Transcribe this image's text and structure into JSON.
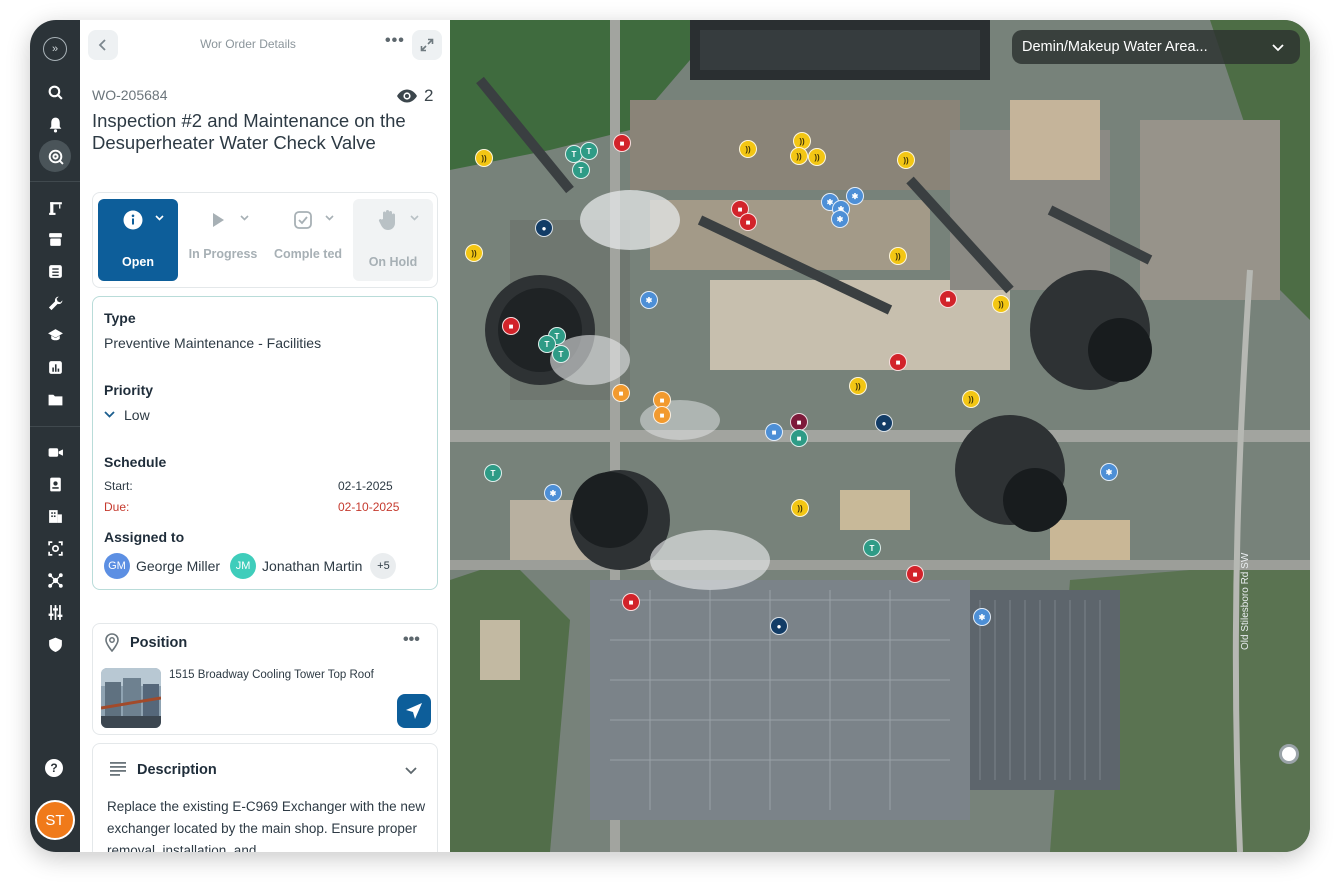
{
  "nav": {
    "user_initials": "ST",
    "items": [
      "search-icon",
      "bell-icon",
      "map-search-icon",
      "crane-icon",
      "archive-icon",
      "list-icon",
      "wrench-icon",
      "graduation-icon",
      "chart-icon",
      "folder-icon",
      "video-icon",
      "badge-icon",
      "building-icon",
      "scan-icon",
      "network-icon",
      "sliders-icon",
      "shield-icon"
    ]
  },
  "header": {
    "title": "Wor Order Details"
  },
  "work_order": {
    "id": "WO-205684",
    "views": "2",
    "title": "Inspection #2 and Maintenance on the Desuperheater Water Check Valve"
  },
  "statuses": [
    {
      "label": "Open",
      "active": true
    },
    {
      "label": "In Progress",
      "active": false
    },
    {
      "label": "Comple ted",
      "active": false
    },
    {
      "label": "On Hold",
      "active": false
    }
  ],
  "details": {
    "type_label": "Type",
    "type_value": "Preventive Maintenance - Facilities",
    "priority_label": "Priority",
    "priority_value": "Low",
    "schedule_label": "Schedule",
    "start_label": "Start:",
    "start_value": "02-1-2025",
    "due_label": "Due:",
    "due_value": "02-10-2025",
    "assigned_label": "Assigned to",
    "assignees": [
      {
        "initials": "GM",
        "name": "George Miller"
      },
      {
        "initials": "JM",
        "name": "Jonathan Martin"
      }
    ],
    "more_assignees": "+5"
  },
  "position": {
    "title": "Position",
    "address": "1515 Broadway Cooling Tower Top Roof"
  },
  "description": {
    "title": "Description",
    "text": "Replace the existing E-C969 Exchanger with the new exchanger located by the main shop. Ensure proper removal, installation, and"
  },
  "map": {
    "area_selector": "Demin/Makeup Water Area...",
    "road_label": "Old Stilesboro Rd SW"
  },
  "colors": {
    "primary": "#0d5e9a",
    "rail": "#2b3338",
    "due": "#c53a2e",
    "avatar": "#f07a1a"
  }
}
